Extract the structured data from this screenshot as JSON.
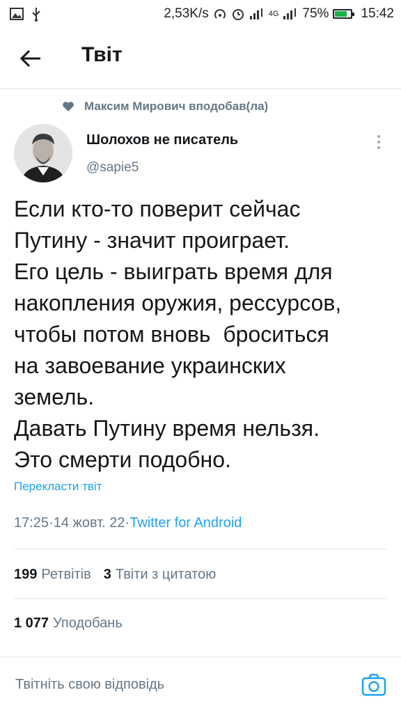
{
  "status_bar": {
    "speed": "2,53K/s",
    "network": "4G",
    "battery": "75%",
    "battery_level": 0.75,
    "time": "15:42",
    "icons": [
      "image-icon",
      "usb-icon",
      "hotspot-icon",
      "alarm-icon",
      "signal-icon",
      "battery-icon"
    ]
  },
  "header": {
    "title": "Твіт"
  },
  "tweet": {
    "social_context": "Максим Мирович вподобав(ла)",
    "author_name": "Шолохов не писатель",
    "author_handle": "@sapie5",
    "text": "Если кто-то поверит сейчас\nПутину - значит проиграет.\nЕго цель - выиграть время для\nнакопления оружия, рессурсов,\nчтобы потом вновь  броситься\nна завоевание украинских\nземель.\nДавать Путину время нельзя.\nЭто смерти подобно.",
    "translate_label": "Перекласти твіт",
    "time": "17:25",
    "date": "14 жовт. 22",
    "source": "Twitter for Android",
    "separator": " · "
  },
  "stats": {
    "retweets_count": "199",
    "retweets_label": "Ретвітів",
    "quotes_count": "3",
    "quotes_label": "Твіти з цитатою",
    "likes_count": "1 077",
    "likes_label": "Уподобань"
  },
  "reply": {
    "placeholder": "Твітніть свою відповідь"
  },
  "colors": {
    "accent": "#1da1f2",
    "muted": "#657786",
    "text": "#14171a",
    "divider": "#e1e8ed"
  }
}
